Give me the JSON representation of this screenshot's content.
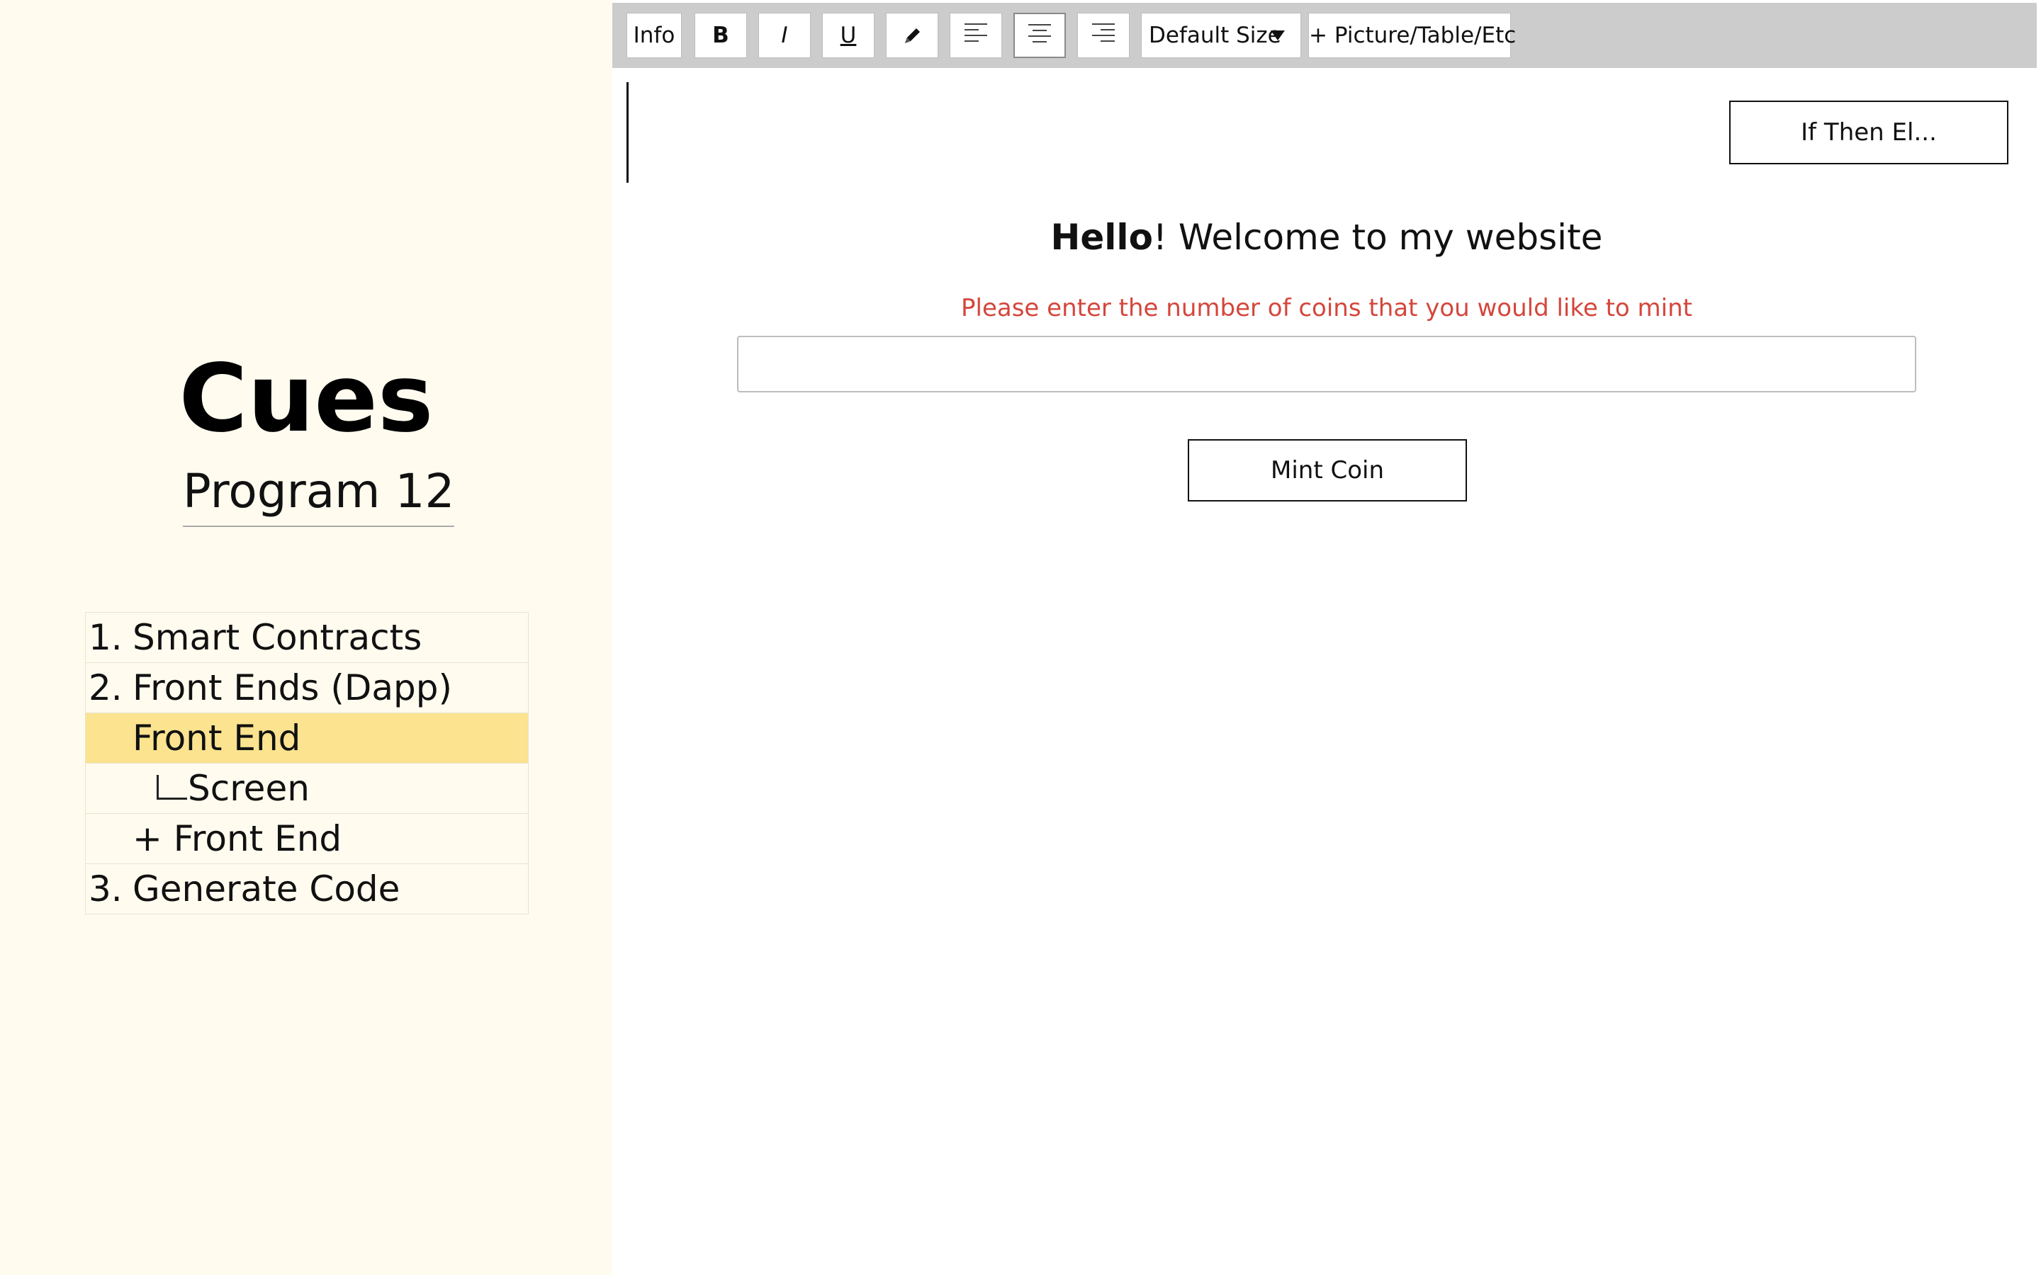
{
  "sidebar": {
    "app_title": "Cues",
    "program_name": "Program 12",
    "nav": [
      {
        "number": "1.",
        "label": "Smart Contracts"
      },
      {
        "number": "2.",
        "label": "Front Ends (Dapp)"
      },
      {
        "number": "",
        "label": "Front End",
        "selected": true
      },
      {
        "number": "",
        "label": "Screen"
      },
      {
        "number": "",
        "label": "+ Front End"
      },
      {
        "number": "3.",
        "label": "Generate Code"
      }
    ]
  },
  "toolbar": {
    "info": "Info",
    "bold": "B",
    "italic": "I",
    "underline": "U",
    "pen_icon": "pen-icon",
    "align_left_icon": "align-left-icon",
    "align_center_icon": "align-center-icon",
    "align_right_icon": "align-right-icon",
    "size_select": "Default Size",
    "insert": "+ Picture/Table/Etc"
  },
  "canvas": {
    "if_then_button": "If Then El...",
    "welcome_bold": "Hello",
    "welcome_rest": "! Welcome to my website",
    "prompt": "Please enter the number of coins that you would like to mint",
    "coin_input_value": "",
    "mint_button": "Mint Coin"
  },
  "colors": {
    "sidebar_bg": "#fffcef",
    "selected_row": "#fbe38f",
    "toolbar_bg": "#cccccc",
    "prompt_text": "#d4463c"
  }
}
